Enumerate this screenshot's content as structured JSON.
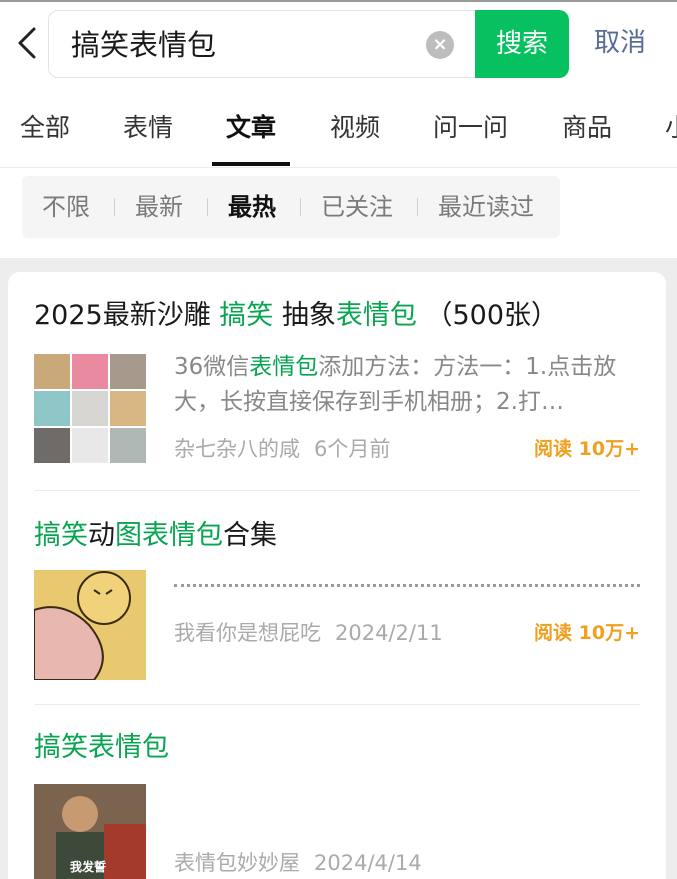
{
  "search": {
    "query": "搞笑表情包",
    "clear_symbol": "×",
    "search_label": "搜索",
    "cancel_label": "取消"
  },
  "tabs": [
    {
      "label": "全部"
    },
    {
      "label": "表情"
    },
    {
      "label": "文章",
      "active": true
    },
    {
      "label": "视频"
    },
    {
      "label": "问一问"
    },
    {
      "label": "商品"
    },
    {
      "label": "小"
    }
  ],
  "filters": [
    {
      "label": "不限"
    },
    {
      "label": "最新"
    },
    {
      "label": "最热",
      "active": true
    },
    {
      "label": "已关注"
    },
    {
      "label": "最近读过"
    }
  ],
  "articles": [
    {
      "title_parts": [
        "2025最新沙雕 ",
        "搞笑",
        " 抽象",
        "表情包",
        " （500张）"
      ],
      "snippet_parts": [
        "36微信",
        "表情包",
        "添加方法：方法一：1.点击放大，长按直接保存到手机相册；2.打…"
      ],
      "author": "杂七杂八的咸",
      "time": "6个月前",
      "reads": "阅读 10万+"
    },
    {
      "title_parts": [
        "搞笑",
        "动",
        "图表情包",
        "合集"
      ],
      "author": "我看你是想屁吃",
      "time": "2024/2/11",
      "reads": "阅读 10万+"
    },
    {
      "title_parts": [
        "搞笑表情包"
      ],
      "author": "表情包妙妙屋",
      "time": "2024/4/14",
      "thumb_caption": "我发誓"
    }
  ],
  "colors": {
    "accent_green": "#07c160",
    "highlight_green": "#07a550",
    "link_blue": "#576b95",
    "read_orange": "#f0a020"
  }
}
